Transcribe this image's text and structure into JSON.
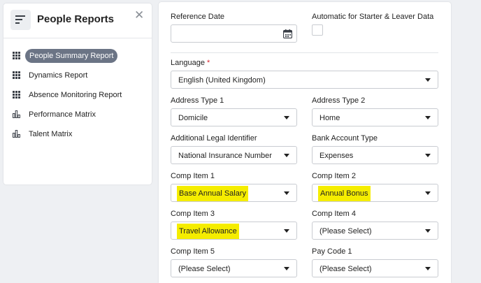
{
  "sidebar": {
    "title": "People Reports",
    "items": [
      {
        "label": "People Summary Report",
        "icon": "grid-icon",
        "active": true
      },
      {
        "label": "Dynamics Report",
        "icon": "grid-icon",
        "active": false
      },
      {
        "label": "Absence Monitoring Report",
        "icon": "grid-icon",
        "active": false
      },
      {
        "label": "Performance Matrix",
        "icon": "bar-chart-icon",
        "active": false
      },
      {
        "label": "Talent Matrix",
        "icon": "bar-chart-icon",
        "active": false
      }
    ]
  },
  "form": {
    "reference_date": {
      "label": "Reference Date",
      "value": ""
    },
    "auto_starter_leaver": {
      "label": "Automatic for Starter & Leaver Data",
      "checked": false
    },
    "language": {
      "label": "Language",
      "required_marker": "*",
      "value": "English (United Kingdom)"
    },
    "address_type_1": {
      "label": "Address Type 1",
      "value": "Domicile"
    },
    "address_type_2": {
      "label": "Address Type 2",
      "value": "Home"
    },
    "additional_legal_identifier": {
      "label": "Additional Legal Identifier",
      "value": "National Insurance Number"
    },
    "bank_account_type": {
      "label": "Bank Account Type",
      "value": "Expenses"
    },
    "comp_item_1": {
      "label": "Comp Item 1",
      "value": "Base Annual Salary"
    },
    "comp_item_2": {
      "label": "Comp Item 2",
      "value": "Annual Bonus"
    },
    "comp_item_3": {
      "label": "Comp Item 3",
      "value": "Travel Allowance"
    },
    "comp_item_4": {
      "label": "Comp Item 4",
      "value": "(Please Select)"
    },
    "comp_item_5": {
      "label": "Comp Item 5",
      "value": "(Please Select)"
    },
    "pay_code_1": {
      "label": "Pay Code 1",
      "value": "(Please Select)"
    }
  },
  "colors": {
    "highlight": "#f5ed00",
    "active_pill": "#6b7485",
    "required": "#d9252f"
  }
}
